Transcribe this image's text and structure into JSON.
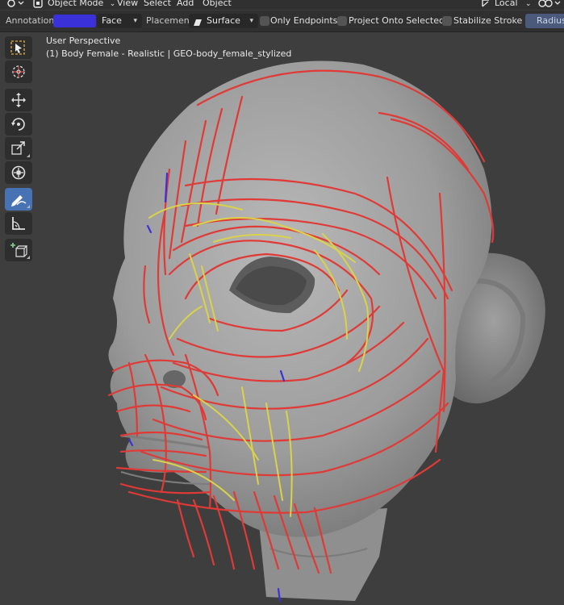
{
  "header": {
    "mode_label": "Object Mode",
    "menu": [
      "View",
      "Select",
      "Add",
      "Object"
    ],
    "transform_orientation": "Local",
    "icons": [
      "editor-type-icon",
      "object-mode-icon",
      "transform-orientation-icon",
      "snap-icon"
    ]
  },
  "tool_settings": {
    "annotation_label": "Annotation:",
    "annotation_color": "#3a32d8",
    "face_value": "Face",
    "placement_label": "Placement:",
    "placement_value": "Surface",
    "only_endpoints_label": "Only Endpoints",
    "project_onto_selected_label": "Project Onto Selected",
    "stabilize_stroke_label": "Stabilize Stroke",
    "radius_label": "Radius"
  },
  "viewport": {
    "perspective_label": "User Perspective",
    "object_label": "(1) Body Female - Realistic | GEO-body_female_stylized",
    "annotation_colors": [
      "#e03a36",
      "#d9d24a",
      "#3a32d8"
    ],
    "mesh_color": "#a2a2a2"
  },
  "toolshelf": {
    "tools": [
      {
        "name": "select-box-icon",
        "active": false
      },
      {
        "name": "cursor-icon",
        "active": false
      },
      {
        "name": "move-icon",
        "active": false
      },
      {
        "name": "rotate-icon",
        "active": false
      },
      {
        "name": "scale-icon",
        "active": false
      },
      {
        "name": "transform-icon",
        "active": false
      },
      {
        "name": "annotate-icon",
        "active": true
      },
      {
        "name": "measure-icon",
        "active": false
      },
      {
        "name": "add-cube-icon",
        "active": false
      }
    ]
  }
}
